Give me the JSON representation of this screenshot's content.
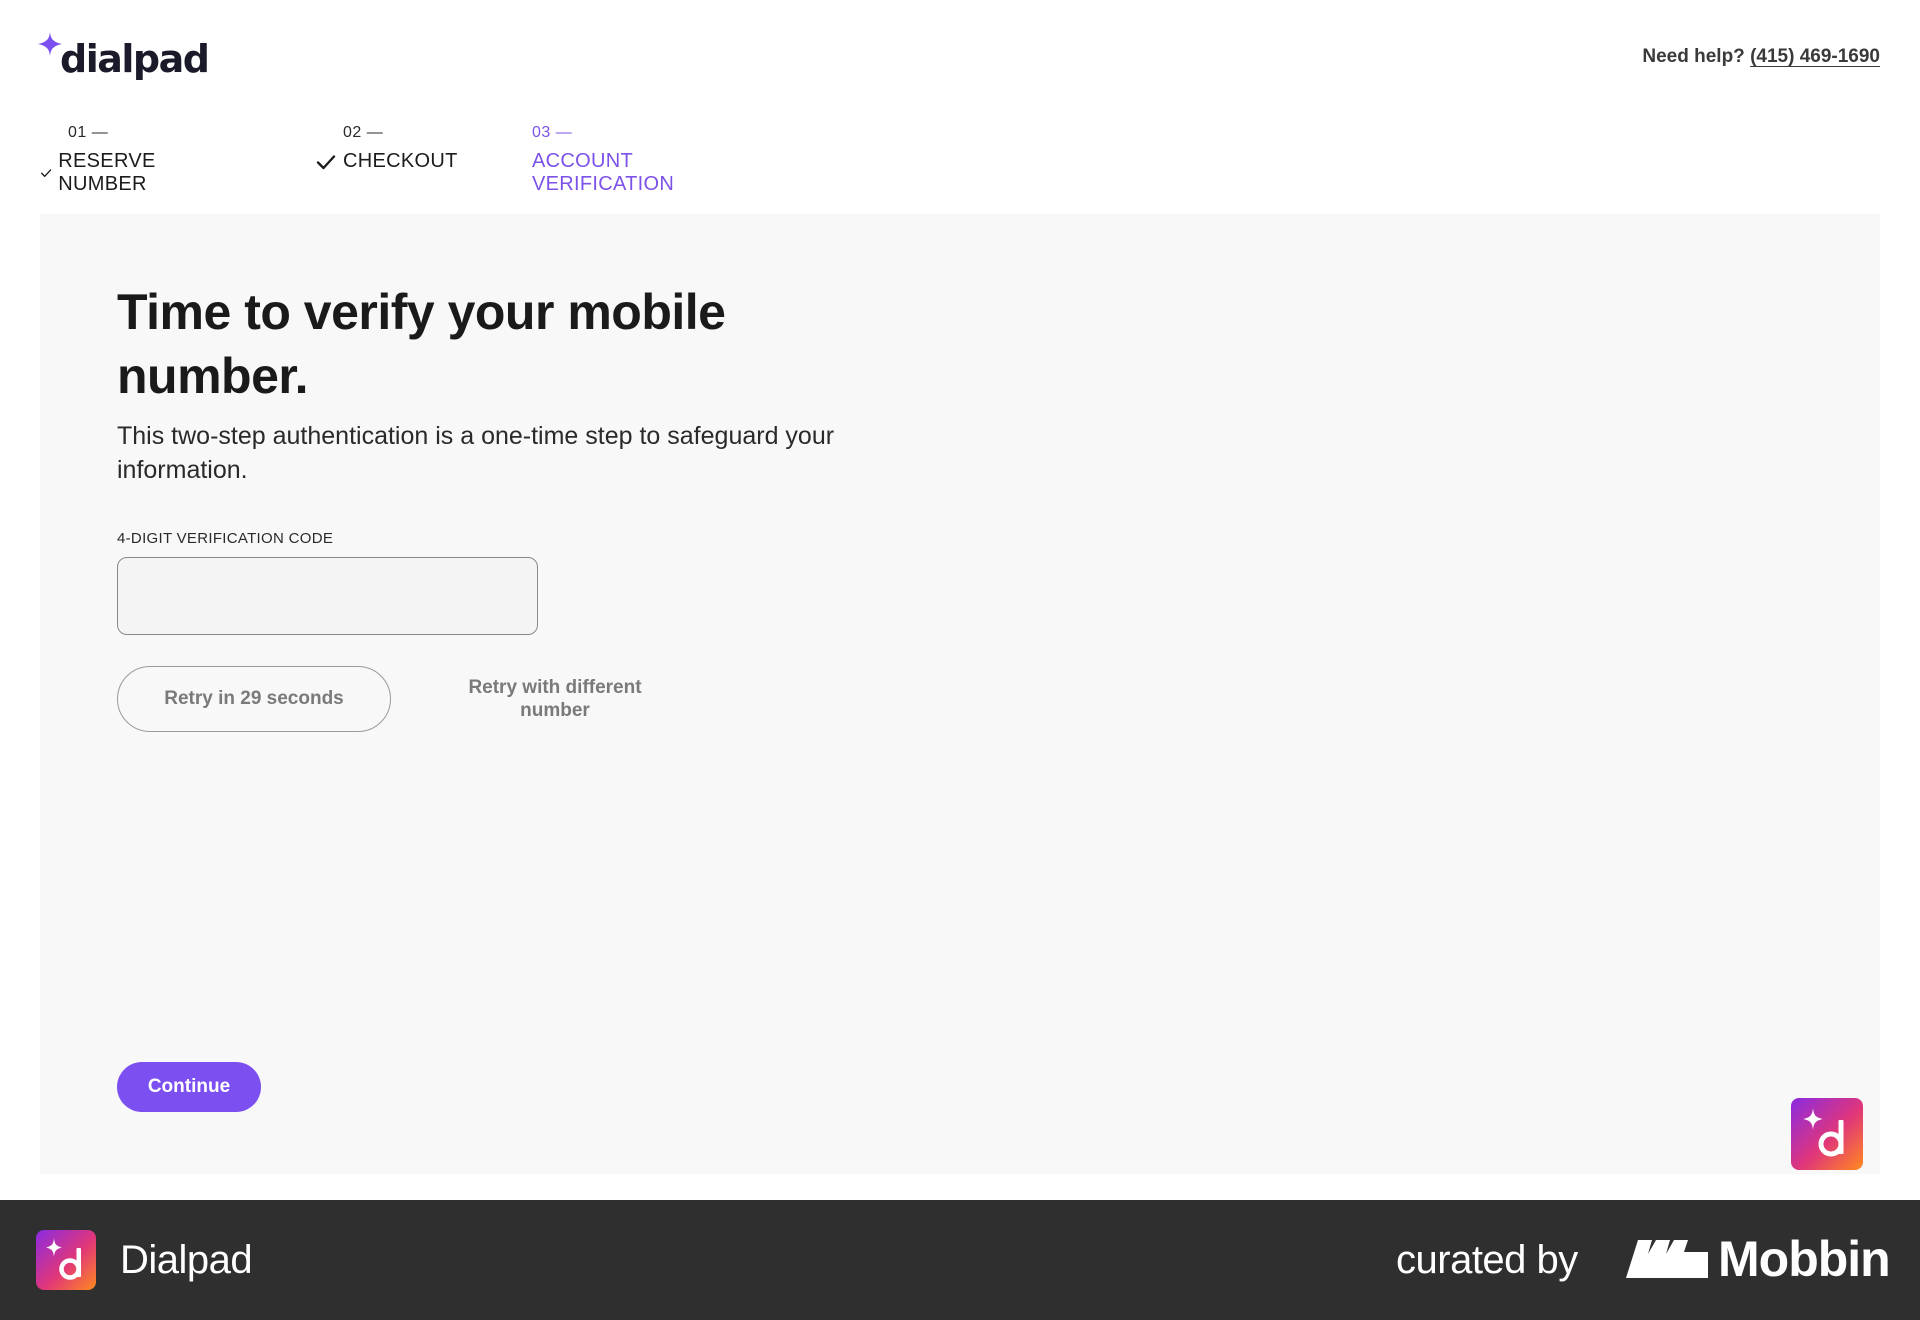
{
  "header": {
    "logo_text": "dialpad",
    "help_label": "Need help?",
    "help_phone": "(415) 469-1690"
  },
  "steps": [
    {
      "num": "01 —",
      "label": "RESERVE NUMBER",
      "state": "completed"
    },
    {
      "num": "02 —",
      "label": "CHECKOUT",
      "state": "completed"
    },
    {
      "num": "03 —",
      "label": "ACCOUNT VERIFICATION",
      "state": "active"
    }
  ],
  "main": {
    "title": "Time to verify your mobile number.",
    "subtitle": "This two-step authentication is a one-time step to safeguard your information.",
    "code_label": "4-DIGIT VERIFICATION CODE",
    "code_value": "",
    "retry_button": "Retry in 29 seconds",
    "retry_different": "Retry with different number",
    "continue_button": "Continue"
  },
  "footer": {
    "app_name": "Dialpad",
    "curated_by": "curated by",
    "brand": "Mobbin"
  },
  "colors": {
    "accent": "#7b4ff0",
    "active_step": "#7c52e8",
    "card_bg": "#f8f8f8",
    "footer_bg": "#2f2f2f"
  },
  "icons": {
    "logo": "sparkle-icon",
    "step_done": "check-icon",
    "app_badge": "dialpad-app-icon"
  }
}
